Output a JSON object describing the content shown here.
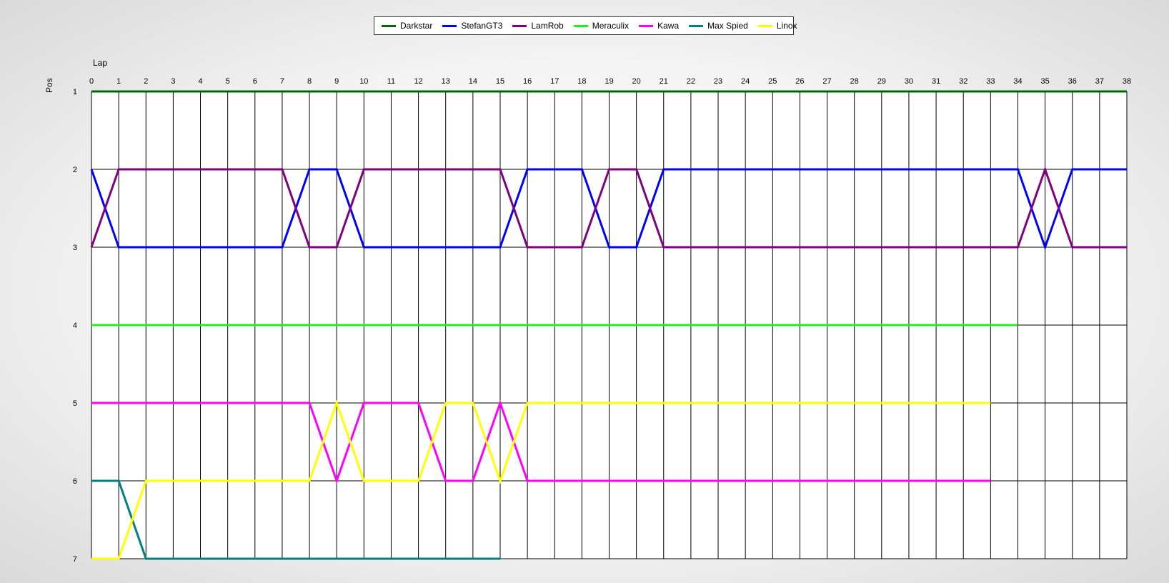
{
  "chart_data": {
    "type": "line",
    "xlabel": "Lap",
    "ylabel": "Pos",
    "xlim": [
      0,
      38
    ],
    "ylim": [
      1,
      7
    ],
    "y_inverted": true,
    "grid": true,
    "legend_position": "top-center",
    "x": [
      0,
      1,
      2,
      3,
      4,
      5,
      6,
      7,
      8,
      9,
      10,
      11,
      12,
      13,
      14,
      15,
      16,
      17,
      18,
      19,
      20,
      21,
      22,
      23,
      24,
      25,
      26,
      27,
      28,
      29,
      30,
      31,
      32,
      33,
      34,
      35,
      36,
      37,
      38
    ],
    "y_ticks": [
      1,
      2,
      3,
      4,
      5,
      6,
      7
    ],
    "series": [
      {
        "name": "Darkstar",
        "color": "#006400",
        "values": [
          1,
          1,
          1,
          1,
          1,
          1,
          1,
          1,
          1,
          1,
          1,
          1,
          1,
          1,
          1,
          1,
          1,
          1,
          1,
          1,
          1,
          1,
          1,
          1,
          1,
          1,
          1,
          1,
          1,
          1,
          1,
          1,
          1,
          1,
          1,
          1,
          1,
          1,
          1
        ]
      },
      {
        "name": "StefanGT3",
        "color": "#0000ff",
        "values": [
          2,
          3,
          3,
          3,
          3,
          3,
          3,
          3,
          2,
          2,
          3,
          3,
          3,
          3,
          3,
          3,
          2,
          2,
          2,
          3,
          3,
          2,
          2,
          2,
          2,
          2,
          2,
          2,
          2,
          2,
          2,
          2,
          2,
          2,
          2,
          3,
          2,
          2,
          2
        ]
      },
      {
        "name": "LamRob",
        "color": "#800080",
        "values": [
          3,
          2,
          2,
          2,
          2,
          2,
          2,
          2,
          3,
          3,
          2,
          2,
          2,
          2,
          2,
          2,
          3,
          3,
          3,
          2,
          2,
          3,
          3,
          3,
          3,
          3,
          3,
          3,
          3,
          3,
          3,
          3,
          3,
          3,
          3,
          2,
          3,
          3,
          3
        ]
      },
      {
        "name": "Meraculix",
        "color": "#22ee22",
        "values": [
          4,
          4,
          4,
          4,
          4,
          4,
          4,
          4,
          4,
          4,
          4,
          4,
          4,
          4,
          4,
          4,
          4,
          4,
          4,
          4,
          4,
          4,
          4,
          4,
          4,
          4,
          4,
          4,
          4,
          4,
          4,
          4,
          4,
          4,
          4
        ]
      },
      {
        "name": "Kawa",
        "color": "#ff00ff",
        "values": [
          5,
          5,
          5,
          5,
          5,
          5,
          5,
          5,
          5,
          6,
          5,
          5,
          5,
          6,
          6,
          5,
          6,
          6,
          6,
          6,
          6,
          6,
          6,
          6,
          6,
          6,
          6,
          6,
          6,
          6,
          6,
          6,
          6,
          6
        ]
      },
      {
        "name": "Max Spied",
        "color": "#008080",
        "values": [
          6,
          6,
          7,
          7,
          7,
          7,
          7,
          7,
          7,
          7,
          7,
          7,
          7,
          7,
          7,
          7
        ]
      },
      {
        "name": "Linox",
        "color": "#ffff00",
        "values": [
          7,
          7,
          6,
          6,
          6,
          6,
          6,
          6,
          6,
          5,
          6,
          6,
          6,
          5,
          5,
          6,
          5,
          5,
          5,
          5,
          5,
          5,
          5,
          5,
          5,
          5,
          5,
          5,
          5,
          5,
          5,
          5,
          5,
          5
        ]
      }
    ]
  }
}
